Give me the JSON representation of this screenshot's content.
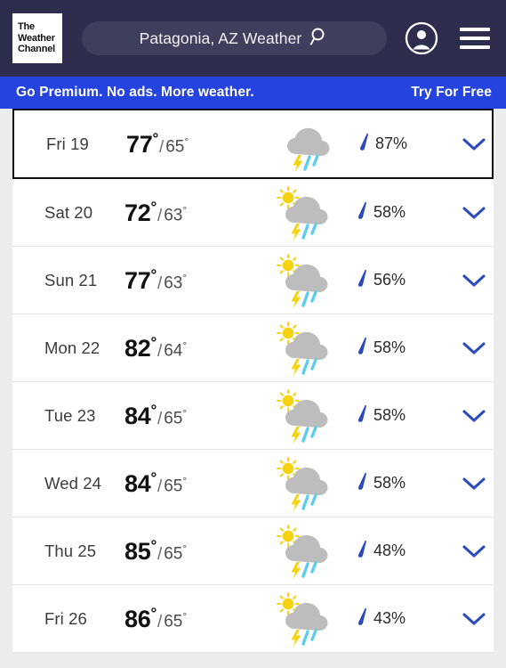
{
  "header": {
    "logo_lines": [
      "The",
      "Weather",
      "Channel"
    ],
    "logo_name": "the-weather-channel-logo",
    "search": {
      "value": "Patagonia, AZ Weather",
      "icon": "search-icon"
    },
    "account_icon": "account-avatar-icon",
    "menu_icon": "hamburger-menu-icon"
  },
  "promo": {
    "message": "Go Premium. No ads. More weather.",
    "cta": "Try For Free",
    "background": "#2543df"
  },
  "forecast": {
    "rows": [
      {
        "day": "Fri 19",
        "high": "77",
        "low": "65",
        "precip": "87%",
        "icon": "thunderstorm-rain-icon",
        "sun": false,
        "focused": true
      },
      {
        "day": "Sat 20",
        "high": "72",
        "low": "63",
        "precip": "58%",
        "icon": "sun-thunderstorm-rain-icon",
        "sun": true,
        "focused": false
      },
      {
        "day": "Sun 21",
        "high": "77",
        "low": "63",
        "precip": "56%",
        "icon": "sun-thunderstorm-rain-icon",
        "sun": true,
        "focused": false
      },
      {
        "day": "Mon 22",
        "high": "82",
        "low": "64",
        "precip": "58%",
        "icon": "sun-thunderstorm-rain-icon",
        "sun": true,
        "focused": false
      },
      {
        "day": "Tue 23",
        "high": "84",
        "low": "65",
        "precip": "58%",
        "icon": "sun-thunderstorm-rain-icon",
        "sun": true,
        "focused": false
      },
      {
        "day": "Wed 24",
        "high": "84",
        "low": "65",
        "precip": "58%",
        "icon": "sun-thunderstorm-rain-icon",
        "sun": true,
        "focused": false
      },
      {
        "day": "Thu 25",
        "high": "85",
        "low": "65",
        "precip": "48%",
        "icon": "sun-thunderstorm-rain-icon",
        "sun": true,
        "focused": false
      },
      {
        "day": "Fri 26",
        "high": "86",
        "low": "65",
        "precip": "43%",
        "icon": "sun-thunderstorm-rain-icon",
        "sun": true,
        "focused": false
      }
    ],
    "degree_symbol": "°",
    "separator": "/",
    "precip_icon": "raindrop-icon",
    "expand_icon": "chevron-down-icon",
    "colors": {
      "accent_blue": "#2b4bbd",
      "cloud_gray": "#bdbdbd",
      "sun_yellow": "#f5d312",
      "rain_cyan": "#5ecdee"
    }
  }
}
